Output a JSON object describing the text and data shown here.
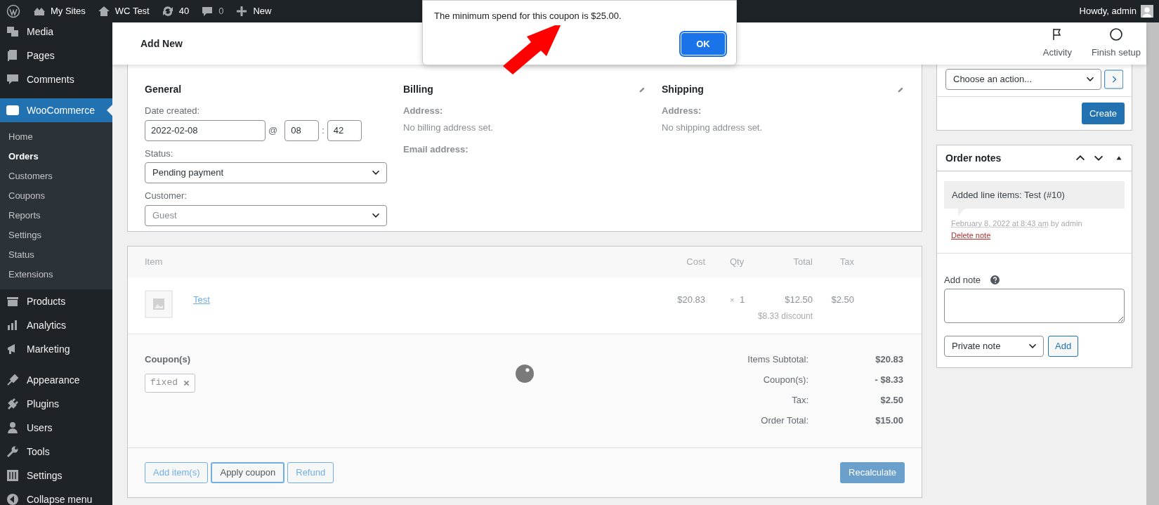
{
  "admin_bar": {
    "items": [
      {
        "kind": "logo"
      },
      {
        "kind": "sites",
        "label": "My Sites"
      },
      {
        "kind": "home",
        "label": "WC Test"
      },
      {
        "kind": "updates",
        "label": "40"
      },
      {
        "kind": "comments",
        "label": "0"
      },
      {
        "kind": "new",
        "label": "New"
      }
    ],
    "account": "Howdy, admin"
  },
  "sidebar": {
    "groups": [
      {
        "items": [
          {
            "label": "Media",
            "selected": false
          },
          {
            "label": "Pages",
            "selected": false
          },
          {
            "label": "Comments",
            "selected": false
          }
        ]
      },
      {
        "items": [
          {
            "label": "WooCommerce",
            "selected": true,
            "children": [
              {
                "label": "Home",
                "selected": false
              },
              {
                "label": "Orders",
                "selected": true
              },
              {
                "label": "Customers",
                "selected": false
              },
              {
                "label": "Coupons",
                "selected": false
              },
              {
                "label": "Reports",
                "selected": false
              },
              {
                "label": "Settings",
                "selected": false
              },
              {
                "label": "Status",
                "selected": false
              },
              {
                "label": "Extensions",
                "selected": false
              }
            ]
          },
          {
            "label": "Products",
            "selected": false
          },
          {
            "label": "Analytics",
            "selected": false
          },
          {
            "label": "Marketing",
            "selected": false
          }
        ]
      },
      {
        "items": [
          {
            "label": "Appearance",
            "selected": false
          },
          {
            "label": "Plugins",
            "selected": false
          },
          {
            "label": "Users",
            "selected": false
          },
          {
            "label": "Tools",
            "selected": false
          },
          {
            "label": "Settings",
            "selected": false
          },
          {
            "label": "Collapse menu",
            "selected": false
          }
        ]
      }
    ]
  },
  "page_header": {
    "title": "Add New",
    "actions": [
      {
        "label": "Activity"
      },
      {
        "label": "Finish setup"
      }
    ]
  },
  "dialog": {
    "message": "The minimum spend for this coupon is $25.00.",
    "button": "OK"
  },
  "order": {
    "general": {
      "heading": "General",
      "date_label": "Date created:",
      "date": "2022-02-08",
      "at": "@",
      "hour": "08",
      "colon": ":",
      "minute": "42",
      "status_label": "Status:",
      "status": "Pending payment",
      "customer_label": "Customer:",
      "customer": "Guest"
    },
    "billing": {
      "heading": "Billing",
      "address_label": "Address:",
      "address": "No billing address set.",
      "email_label": "Email address:"
    },
    "shipping": {
      "heading": "Shipping",
      "address_label": "Address:",
      "address": "No shipping address set."
    }
  },
  "items": {
    "columns": [
      "Item",
      "Cost",
      "Qty",
      "Total",
      "Tax"
    ],
    "rows": [
      {
        "name": "Test",
        "cost": "$20.83",
        "qty_sign": "×",
        "qty": "1",
        "total": "$12.50",
        "discount": "$8.33 discount",
        "tax": "$2.50"
      }
    ],
    "coupons_label": "Coupon(s)",
    "coupons": [
      "fixed"
    ],
    "totals": [
      {
        "label": "Items Subtotal:",
        "value": "$20.83"
      },
      {
        "label": "Coupon(s):",
        "value": "- $8.33"
      },
      {
        "label": "Tax:",
        "value": "$2.50"
      },
      {
        "label": "Order Total:",
        "value": "$15.00"
      }
    ],
    "buttons": [
      {
        "label": "Add item(s)",
        "focused": false
      },
      {
        "label": "Apply coupon",
        "focused": true
      },
      {
        "label": "Refund",
        "focused": false
      }
    ],
    "recalculate": "Recalculate"
  },
  "actions_box": {
    "select": "Choose an action...",
    "button": "Create"
  },
  "notes": {
    "title": "Order notes",
    "items": [
      {
        "text": "Added line items: Test (#10)",
        "date": "February 8, 2022 at 8:43 am",
        "by": "by admin",
        "delete": "Delete note"
      }
    ],
    "add_label": "Add note",
    "note_type": "Private note",
    "add_button": "Add"
  }
}
